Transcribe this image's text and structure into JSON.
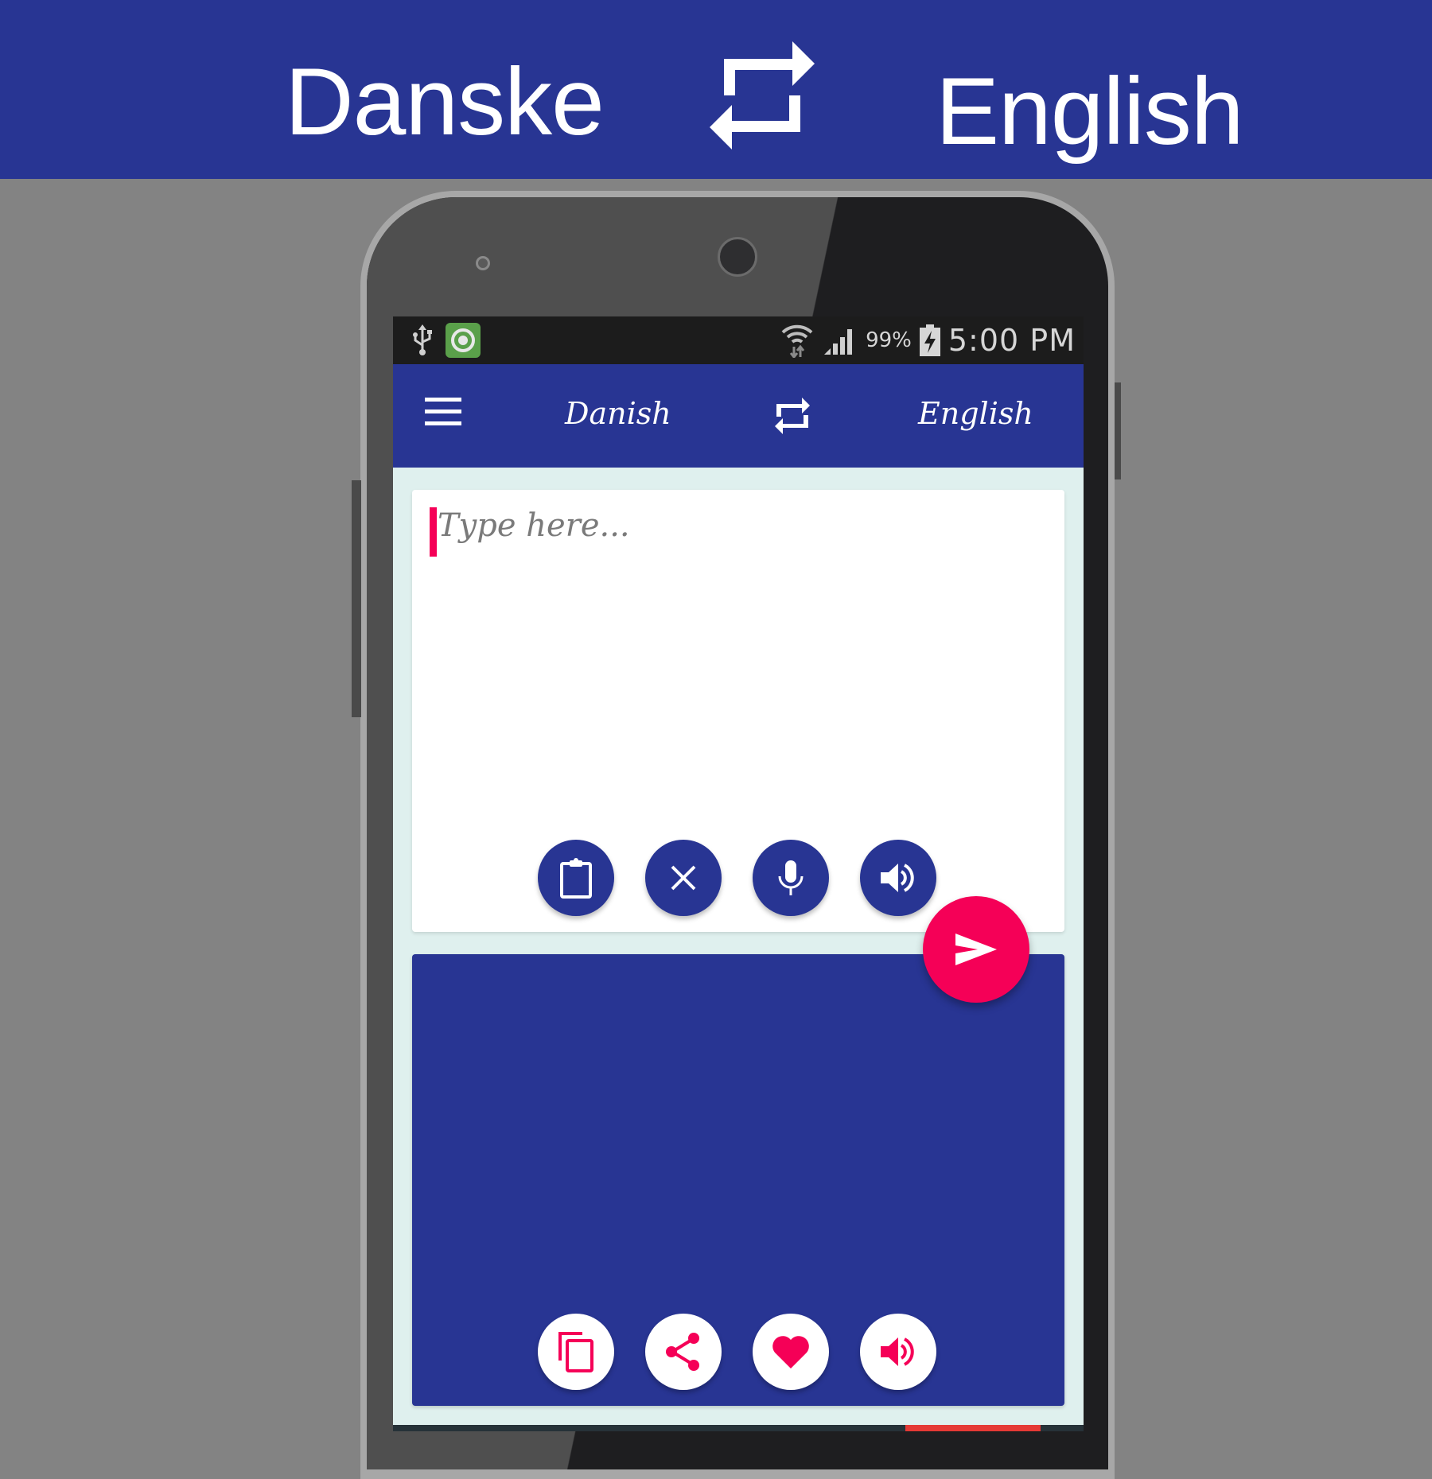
{
  "banner": {
    "source_language": "Danske",
    "target_language": "English",
    "swap_icon": "swap-arrows-icon"
  },
  "status_bar": {
    "left_icons": [
      "usb-icon",
      "app-notification-icon"
    ],
    "wifi_icon": "wifi-icon",
    "signal_icon": "cell-signal-icon",
    "battery_percent": "99%",
    "battery_icon": "battery-charging-icon",
    "time": "5:00 PM"
  },
  "app_bar": {
    "menu_icon": "hamburger-menu-icon",
    "source_language": "Danish",
    "swap_icon": "swap-arrows-icon",
    "target_language": "English"
  },
  "input": {
    "value": "",
    "placeholder": "Type here...",
    "actions": [
      {
        "name": "paste",
        "icon": "clipboard-icon"
      },
      {
        "name": "clear",
        "icon": "close-icon"
      },
      {
        "name": "voice-input",
        "icon": "microphone-icon"
      },
      {
        "name": "speak-input",
        "icon": "speaker-icon"
      }
    ]
  },
  "translate_button": {
    "icon": "send-icon"
  },
  "output": {
    "value": "",
    "actions": [
      {
        "name": "copy",
        "icon": "copy-icon"
      },
      {
        "name": "share",
        "icon": "share-icon"
      },
      {
        "name": "favorite",
        "icon": "heart-icon"
      },
      {
        "name": "speak-output",
        "icon": "speaker-icon"
      }
    ]
  },
  "colors": {
    "primary": "#283593",
    "accent": "#f50057",
    "screen_background": "#dff0ee",
    "status_bar": "#1c1c1c"
  }
}
